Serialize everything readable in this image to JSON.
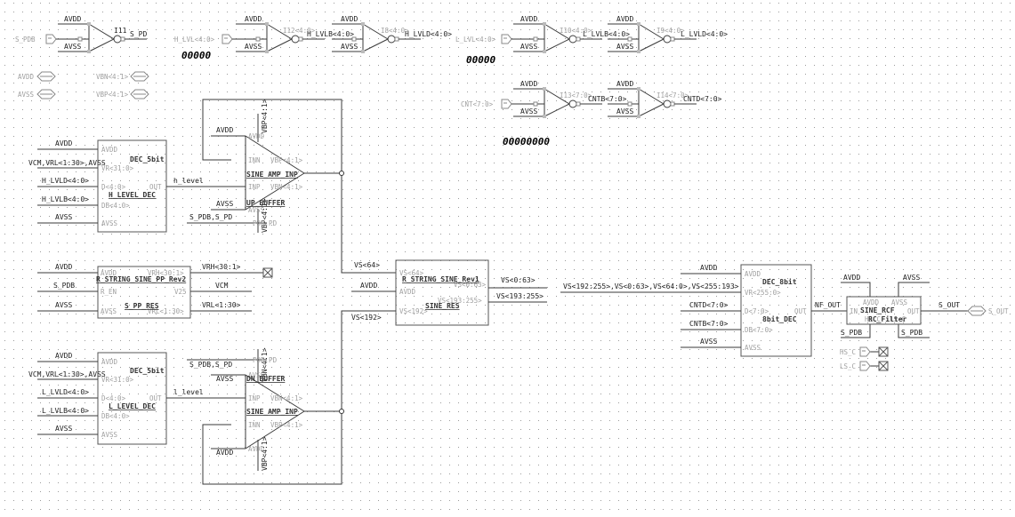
{
  "colors": {
    "background": "#ffffff",
    "wire": "#3a3a3a",
    "pin_label": "#a0a0a0",
    "grid_dot": "#9a9a9a"
  },
  "inverters": [
    {
      "instance": "I11",
      "input": "S_PDB",
      "output": "S_PD",
      "vdd": "AVDD",
      "vss": "AVSS"
    },
    {
      "instance": "I12<4:0>",
      "input": "H_LVL<4:0>",
      "output": "H_LVLB<4:0>",
      "vdd": "AVDD",
      "vss": "AVSS"
    },
    {
      "instance": "I8<4:0>",
      "output": "H_LVLD<4:0>",
      "vdd": "AVDD",
      "vss": "AVSS"
    },
    {
      "instance": "I10<4:0>",
      "input": "L_LVL<4:0>",
      "output": "L_LVLB<4:0>",
      "vdd": "AVDD",
      "vss": "AVSS"
    },
    {
      "instance": "I9<4:0>",
      "output": "L_LVLD<4:0>",
      "vdd": "AVDD",
      "vss": "AVSS"
    },
    {
      "instance": "I13<7:0>",
      "input": "CNT<7:0>",
      "output": "CNTB<7:0>",
      "vdd": "AVDD",
      "vss": "AVSS"
    },
    {
      "instance": "I14<7:0>",
      "output": "CNTD<7:0>",
      "vdd": "AVDD",
      "vss": "AVSS"
    }
  ],
  "bus_values": [
    "00000",
    "00000",
    "00000000"
  ],
  "inout_pins": [
    "AVDD",
    "AVSS",
    "VBN<4:1>",
    "VBP<4:1>"
  ],
  "h_dec": {
    "cell": "DEC_5bit",
    "instance": "H_LEVEL_DEC",
    "pins": [
      "AVDD",
      "VR<31:0>",
      "D<4:0>",
      "DB<4:0>",
      "AVSS",
      "OUT"
    ],
    "nets": [
      "AVDD",
      "VCM,VRL<1:30>,AVSS",
      "H_LVLD<4:0>",
      "H_LVLB<4:0>",
      "AVSS",
      "h_level"
    ]
  },
  "l_dec": {
    "cell": "DEC_5bit",
    "instance": "L_LEVEL_DEC",
    "pins": [
      "AVDD",
      "VR<31:0>",
      "D<4:0>",
      "DB<4:0>",
      "AVSS",
      "OUT"
    ],
    "nets": [
      "AVDD",
      "VCM,VRL<1:30>,AVSS",
      "L_LVLD<4:0>",
      "L_LVLB<4:0>",
      "AVSS",
      "l_level"
    ]
  },
  "up_amp": {
    "cell": "SINE_AMP_INP",
    "instance": "UP_BUFFER",
    "pins": [
      "AVDD",
      "INN",
      "INP",
      "AVSS",
      "PDB,PD",
      "VBP<4:1>",
      "VBN<4:1>"
    ],
    "nets": [
      "AVDD",
      "AVSS",
      "S_PDB,S_PD",
      "VBP<4:1>",
      "VBP<4:1>"
    ]
  },
  "dn_amp": {
    "cell": "SINE_AMP_INP",
    "instance": "DN_BUFFER",
    "pins": [
      "PDB,PD",
      "AVSS",
      "INP",
      "INN",
      "AVDD",
      "VBN<4:1>",
      "VBP<4:1>"
    ],
    "nets": [
      "S_PDB,S_PD",
      "AVSS",
      "AVDD",
      "VBN<4:1>",
      "VBP<4:1>"
    ]
  },
  "pp_res": {
    "cell": "R_STRING_SINE_PP_Rev2",
    "instance": "S_PP_RES",
    "pins": [
      "AVDD",
      "R_EN",
      "AVSS",
      "VRH<30:1>",
      "V25",
      "VRL<1:30>"
    ],
    "nets": [
      "AVDD",
      "S_PDB",
      "AVSS",
      "VRH<30:1>",
      "VCM",
      "VRL<1:30>"
    ]
  },
  "sine_res": {
    "cell": "R_STRING_SINE_Rev1",
    "instance": "SINE_RES",
    "pins": [
      "VS<64>",
      "AVDD",
      "VS<192>",
      "VS<0:63>",
      "VS<193:255>"
    ],
    "nets": [
      "VS<64>",
      "AVDD",
      "VS<192>",
      "VS<0:63>",
      "VS<193:255>"
    ]
  },
  "dec8": {
    "cell": "DEC_8bit",
    "instance": "8bit_DEC",
    "pins": [
      "AVDD",
      "VR<255:0>",
      "D<7:0>",
      "DB<7:0>",
      "AVSS",
      "OUT"
    ],
    "nets": [
      "AVDD",
      "VS<192:255>,VS<0:63>,VS<64:0>,VS<255:193>",
      "CNTD<7:0>",
      "CNTB<7:0>",
      "AVSS",
      "NF_OUT"
    ]
  },
  "rcf": {
    "cell": "SINE_RCF",
    "instance": "RC_Filter",
    "pins": [
      "AVDD",
      "AVSS",
      "IN",
      "OUT",
      "HS_C",
      "LS_C"
    ],
    "nets": [
      "AVDD",
      "AVSS",
      "S_PDB",
      "S_PDB",
      "S_OUT"
    ],
    "out_pin": "S_OUT",
    "noconn_pins": [
      "HS_C",
      "LS_C"
    ]
  }
}
